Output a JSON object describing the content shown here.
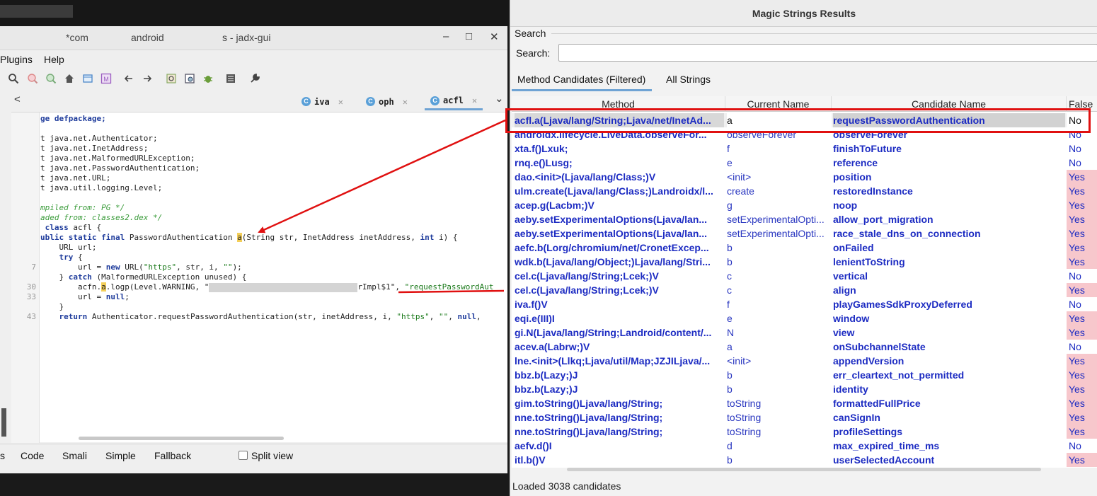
{
  "jadx": {
    "title_parts": [
      "*com",
      "android",
      "s - jadx-gui"
    ],
    "window_controls": {
      "minimize": "–",
      "maximize": "□",
      "close": "✕"
    },
    "menu": [
      "Plugins",
      "Help"
    ],
    "tabs": [
      {
        "label": "iva",
        "icon": "C"
      },
      {
        "label": "oph",
        "icon": "C"
      },
      {
        "label": "acfl",
        "icon": "C"
      }
    ],
    "tab_nav_left": "<",
    "tab_dropdown": "⌄",
    "gutter_numbers": [
      "7",
      "30",
      "33",
      "43"
    ],
    "code_lines": {
      "l1": "ge defpackage;",
      "l2": "t java.net.Authenticator;",
      "l3": "t java.net.InetAddress;",
      "l4": "t java.net.MalformedURLException;",
      "l5": "t java.net.PasswordAuthentication;",
      "l6": "t java.net.URL;",
      "l7": "t java.util.logging.Level;",
      "c1": "mpiled from: PG */",
      "c2": "aded from: classes2.dex */",
      "cls_kw": "class",
      "cls_name": " acfl {",
      "sig_kw": "ublic static final",
      "sig_type": " PasswordAuthentication ",
      "sig_method": "a",
      "sig_args1": "(String str, InetAddress inetAddress, ",
      "sig_int": "int",
      "sig_args2": " i) {",
      "url_decl": "    URL url;",
      "try_kw": "try",
      "try_rest": " {",
      "url_assign1": "        url = ",
      "new_kw": "new",
      "url_assign2": " URL(",
      "url_s1": "\"https\"",
      "url_mid": ", str, i, ",
      "url_s2": "\"\"",
      "url_end": ");",
      "catch_pre": "    } ",
      "catch_kw": "catch",
      "catch_rest": " (MalformedURLException unused) {",
      "log_pre": "        acfn.",
      "log_hl": "a",
      "log_mid": ".logp(Level.WARNING, \"",
      "log_after": "rImpl$1\", ",
      "log_str": "\"requestPasswordAut",
      "null_pre": "        url = ",
      "null_kw": "null",
      "null_end": ";",
      "close_brace": "    }",
      "ret_kw": "return",
      "ret_mid": " Authenticator.requestPasswordAuthentication(str, inetAddress, i, ",
      "ret_s1": "\"https\"",
      "ret_sep": ", ",
      "ret_s2": "\"\"",
      "ret_sep2": ", ",
      "ret_null": "null",
      "ret_end": ","
    },
    "bottom_tabs": [
      "s",
      "Code",
      "Smali",
      "Simple",
      "Fallback"
    ],
    "split_view": "Split view"
  },
  "magic": {
    "title": "Magic Strings Results",
    "search_group": "Search",
    "search_label": "Search:",
    "search_value": "",
    "tabs": [
      "Method Candidates (Filtered)",
      "All Strings"
    ],
    "columns": [
      "Method",
      "Current Name",
      "Candidate Name",
      "False"
    ],
    "rows": [
      [
        "acfl.a(Ljava/lang/String;Ljava/net/InetAd...",
        "a",
        "requestPasswordAuthentication",
        "No"
      ],
      [
        "androidx.lifecycle.LiveData.observeFor...",
        "observeForever",
        "observeForever",
        "No"
      ],
      [
        "xta.f()Lxuk;",
        "f",
        "finishToFuture",
        "No"
      ],
      [
        "rnq.e()Lusg;",
        "e",
        "reference",
        "No"
      ],
      [
        "dao.<init>(Ljava/lang/Class;)V",
        "<init>",
        "position",
        "Yes"
      ],
      [
        "ulm.create(Ljava/lang/Class;)Landroidx/l...",
        "create",
        "restoredInstance",
        "Yes"
      ],
      [
        "acep.g(Lacbm;)V",
        "g",
        "noop",
        "Yes"
      ],
      [
        "aeby.setExperimentalOptions(Ljava/lan...",
        "setExperimentalOpti...",
        "allow_port_migration",
        "Yes"
      ],
      [
        "aeby.setExperimentalOptions(Ljava/lan...",
        "setExperimentalOpti...",
        "race_stale_dns_on_connection",
        "Yes"
      ],
      [
        "aefc.b(Lorg/chromium/net/CronetExcep...",
        "b",
        "onFailed",
        "Yes"
      ],
      [
        "wdk.b(Ljava/lang/Object;)Ljava/lang/Stri...",
        "b",
        "lenientToString",
        "Yes"
      ],
      [
        "cel.c(Ljava/lang/String;Lcek;)V",
        "c",
        "vertical",
        "No"
      ],
      [
        "cel.c(Ljava/lang/String;Lcek;)V",
        "c",
        "align",
        "Yes"
      ],
      [
        "iva.f()V",
        "f",
        "playGamesSdkProxyDeferred",
        "No"
      ],
      [
        "eqi.e(III)I",
        "e",
        "window",
        "Yes"
      ],
      [
        "gi.N(Ljava/lang/String;Landroid/content/...",
        "N",
        "view",
        "Yes"
      ],
      [
        "acev.a(Labrw;)V",
        "a",
        "onSubchannelState",
        "No"
      ],
      [
        "lne.<init>(Llkq;Ljava/util/Map;JZJILjava/...",
        "<init>",
        "appendVersion",
        "Yes"
      ],
      [
        "bbz.b(Lazy;)J",
        "b",
        "err_cleartext_not_permitted",
        "Yes"
      ],
      [
        "bbz.b(Lazy;)J",
        "b",
        "identity",
        "Yes"
      ],
      [
        "gim.toString()Ljava/lang/String;",
        "toString",
        "formattedFullPrice",
        "Yes"
      ],
      [
        "nne.toString()Ljava/lang/String;",
        "toString",
        "canSignIn",
        "Yes"
      ],
      [
        "nne.toString()Ljava/lang/String;",
        "toString",
        "profileSettings",
        "Yes"
      ],
      [
        "aefv.d()I",
        "d",
        "max_expired_time_ms",
        "No"
      ],
      [
        "itl.b()V",
        "b",
        "userSelectedAccount",
        "Yes"
      ]
    ],
    "status": "Loaded 3038 candidates"
  },
  "colors": {
    "annotation_red": "#e01010",
    "method_blue": "#1c2bc2",
    "false_positive_yes_bg": "#f7c7cc",
    "active_tab_underline": "#6fa3d4"
  }
}
